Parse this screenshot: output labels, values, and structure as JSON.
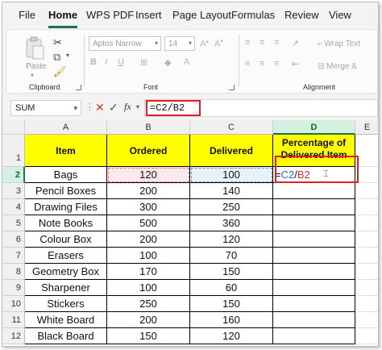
{
  "ribbon": {
    "tabs": [
      "File",
      "Home",
      "WPS PDF",
      "Insert",
      "Page Layout",
      "Formulas",
      "Review",
      "View"
    ],
    "active_tab": "Home",
    "clipboard": {
      "paste_label": "Paste",
      "group_label": "Clipboard"
    },
    "font": {
      "font_name": "Aptos Narrow",
      "font_size": "14",
      "group_label": "Font"
    },
    "alignment": {
      "wrap_text_label": "Wrap Text",
      "merge_label": "Merge &",
      "group_label": "Alignment"
    }
  },
  "formula_bar": {
    "name_box": "SUM",
    "formula": "=C2/B2",
    "fx_label": "fx"
  },
  "sheet": {
    "columns": [
      "A",
      "B",
      "C",
      "D"
    ],
    "extra_column": "E",
    "rows": [
      "1",
      "2",
      "3",
      "4",
      "5",
      "6",
      "7",
      "8",
      "9",
      "10",
      "11",
      "12"
    ],
    "headers": [
      "Item",
      "Ordered",
      "Delivered",
      "Percentage of Delivered Item"
    ],
    "header_line1": "Percentage of",
    "header_line2": "Delivered Item",
    "data": [
      [
        "Bags",
        "120",
        "100"
      ],
      [
        "Pencil Boxes",
        "200",
        "140"
      ],
      [
        "Drawing Files",
        "300",
        "250"
      ],
      [
        "Note Books",
        "500",
        "360"
      ],
      [
        "Colour Box",
        "200",
        "120"
      ],
      [
        "Erasers",
        "100",
        "70"
      ],
      [
        "Geometry Box",
        "170",
        "150"
      ],
      [
        "Sharpener",
        "100",
        "60"
      ],
      [
        "Stickers",
        "250",
        "150"
      ],
      [
        "White Board",
        "200",
        "160"
      ],
      [
        "Black Board",
        "150",
        "120"
      ]
    ],
    "editing_cell": {
      "eq": "=",
      "ref1": "C2",
      "slash": "/",
      "ref2": "B2"
    }
  },
  "colors": {
    "accent": "#1e7145",
    "header_fill": "#ffff00",
    "highlight_red": "#e02020",
    "ref_blue": "#2f6fd0",
    "ref_red": "#c0392b"
  }
}
